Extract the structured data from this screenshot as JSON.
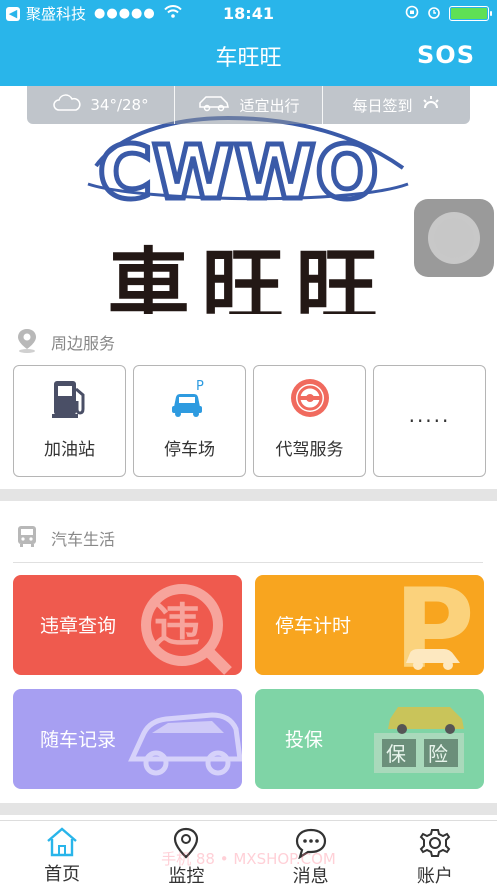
{
  "status_bar": {
    "carrier": "聚盛科技",
    "signal": "●●●●●",
    "time": "18:41"
  },
  "navbar": {
    "title": "车旺旺",
    "sos": "SOS"
  },
  "info_bar": {
    "temperature": "34°/28°",
    "travel": "适宜出行",
    "signin": "每日签到"
  },
  "hero": {
    "logo_text": "CWWO",
    "brand": "車旺旺"
  },
  "nearby": {
    "title": "周边服务",
    "items": [
      {
        "label": "加油站",
        "icon": "gas-station-icon"
      },
      {
        "label": "停车场",
        "icon": "parking-car-icon"
      },
      {
        "label": "代驾服务",
        "icon": "steering-wheel-icon"
      },
      {
        "label": "·····",
        "icon": "more-icon"
      }
    ]
  },
  "car_life": {
    "title": "汽车生活",
    "tiles": [
      {
        "label": "违章查询",
        "color": "#ef5a4e"
      },
      {
        "label": "停车计时",
        "color": "#f8a51f"
      },
      {
        "label": "随车记录",
        "color": "#a79ff2"
      },
      {
        "label": "投保",
        "color": "#7fd4a6"
      }
    ]
  },
  "tabs": [
    {
      "label": "首页",
      "icon": "home-icon",
      "active": true
    },
    {
      "label": "监控",
      "icon": "location-pin-icon"
    },
    {
      "label": "消息",
      "icon": "chat-bubble-icon"
    },
    {
      "label": "账户",
      "icon": "gear-icon"
    }
  ],
  "watermark": "手机 88 • MXSHOP.COM",
  "colors": {
    "brand_blue": "#29b5ea",
    "logo_blue": "#3a5aa8"
  }
}
